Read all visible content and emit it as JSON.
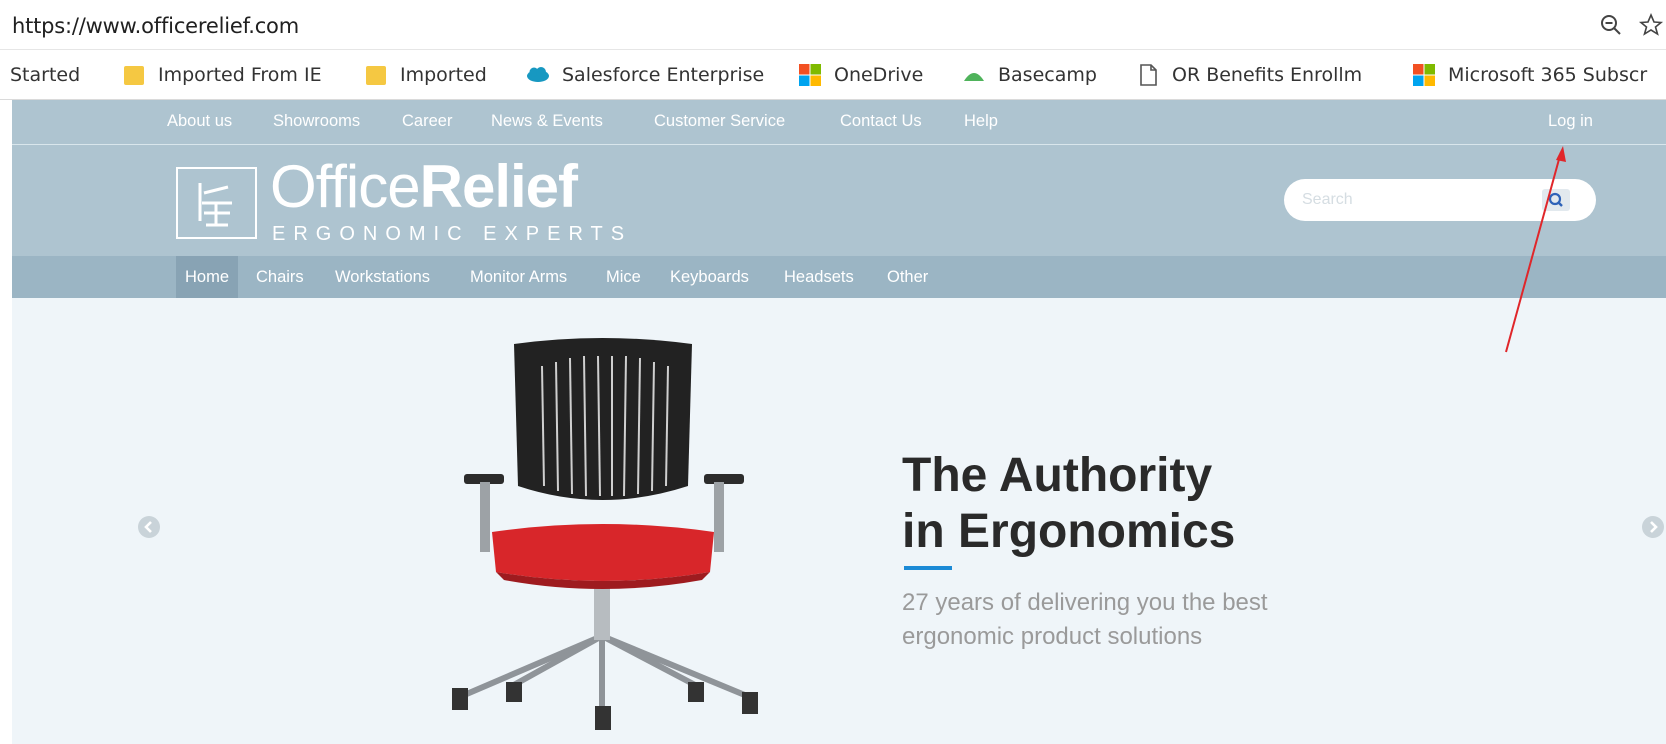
{
  "browser": {
    "url": "https://www.officerelief.com",
    "icons": {
      "zoom": "zoom-out-icon",
      "star": "bookmark-star-icon"
    }
  },
  "bookmarks": [
    {
      "label": "Started",
      "icon": "none"
    },
    {
      "label": "Imported From IE",
      "icon": "folder-icon"
    },
    {
      "label": "Imported",
      "icon": "folder-icon"
    },
    {
      "label": "Salesforce Enterprise",
      "icon": "salesforce-cloud-icon"
    },
    {
      "label": "OneDrive",
      "icon": "microsoft-logo-icon"
    },
    {
      "label": "Basecamp",
      "icon": "basecamp-icon"
    },
    {
      "label": "OR Benefits Enrollme",
      "icon": "page-icon"
    },
    {
      "label": "Microsoft 365 Subscr",
      "icon": "microsoft-logo-icon"
    }
  ],
  "site": {
    "topnav": [
      "About us",
      "Showrooms",
      "Career",
      "News & Events",
      "Customer Service",
      "Contact Us",
      "Help"
    ],
    "login": "Log in",
    "logo": {
      "office": "Office",
      "relief": "Relief",
      "tagline": "ERGONOMIC EXPERTS"
    },
    "search": {
      "placeholder": "Search"
    },
    "categories": [
      "Home",
      "Chairs",
      "Workstations",
      "Monitor Arms",
      "Mice",
      "Keyboards",
      "Headsets",
      "Other"
    ],
    "active_category": "Home",
    "hero": {
      "headline_line1": "The Authority",
      "headline_line2": "in Ergonomics",
      "subtext": "27 years of delivering you the best ergonomic product solutions"
    },
    "colors": {
      "nav_bg": "#aec4d0",
      "category_bg": "#9bb5c4",
      "accent": "#1b8ad6",
      "seat_red": "#d8262a",
      "annotation_arrow": "#e0262a"
    }
  }
}
